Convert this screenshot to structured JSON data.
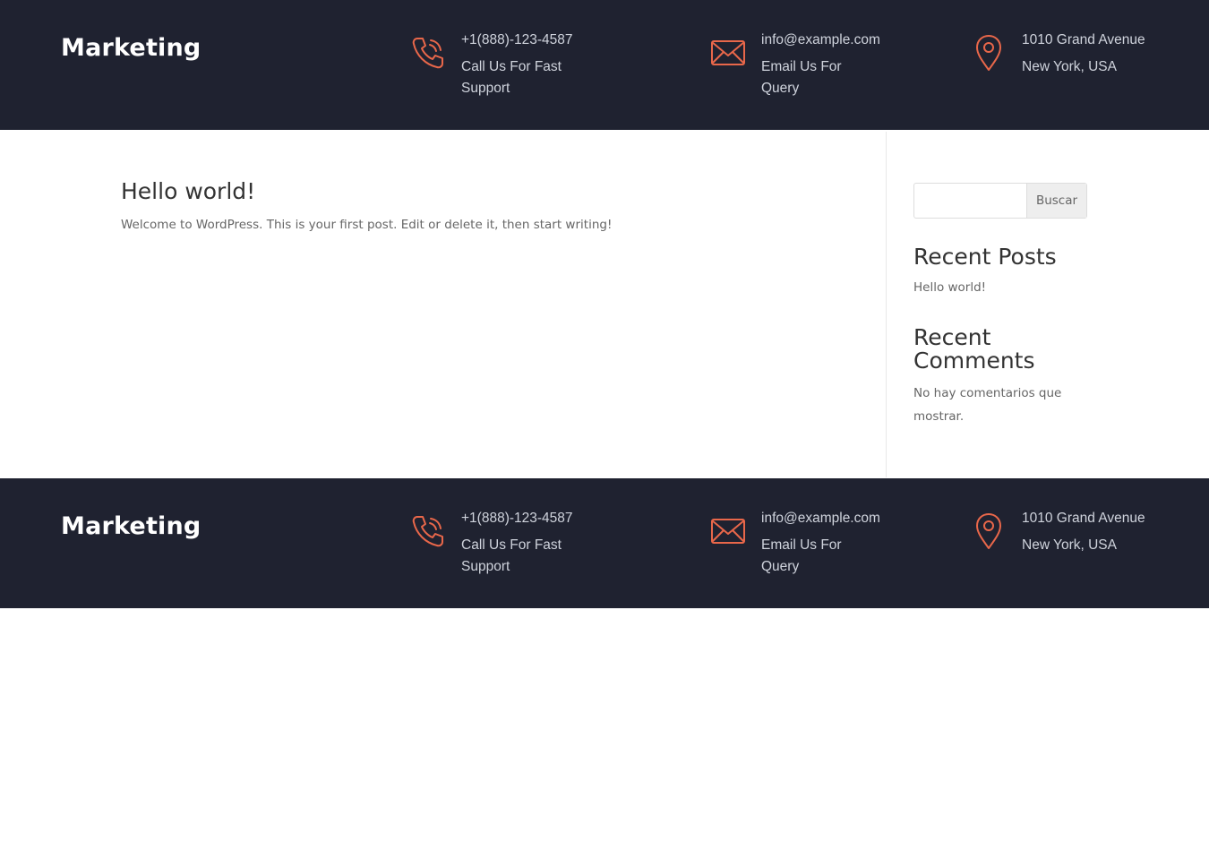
{
  "colors": {
    "accent": "#e8674a",
    "bar_bg": "#1f2230"
  },
  "header": {
    "logo": "Marketing",
    "phone": {
      "icon": "phone-icon",
      "line1": "+1(888)-123-4587",
      "line2": "Call Us For Fast",
      "line3": "Support"
    },
    "email": {
      "icon": "mail-icon",
      "line1": "info@example.com",
      "line2": "Email Us For",
      "line3": "Query"
    },
    "address": {
      "icon": "location-pin-icon",
      "line1": "1010 Grand Avenue",
      "line2": "New York, USA"
    }
  },
  "post": {
    "title": "Hello world!",
    "excerpt": "Welcome to WordPress. This is your first post. Edit or delete it, then start writing!"
  },
  "sidebar": {
    "search_button": "Buscar",
    "recent_posts_title": "Recent Posts",
    "recent_posts": [
      "Hello world!"
    ],
    "recent_comments_title": "Recent Comments",
    "recent_comments_empty": "No hay comentarios que mostrar."
  },
  "footer": {
    "logo": "Marketing",
    "phone": {
      "line1": "+1(888)-123-4587",
      "line2": "Call Us For Fast",
      "line3": "Support"
    },
    "email": {
      "line1": "info@example.com",
      "line2": "Email Us For",
      "line3": "Query"
    },
    "address": {
      "line1": "1010 Grand Avenue",
      "line2": "New York, USA"
    }
  }
}
